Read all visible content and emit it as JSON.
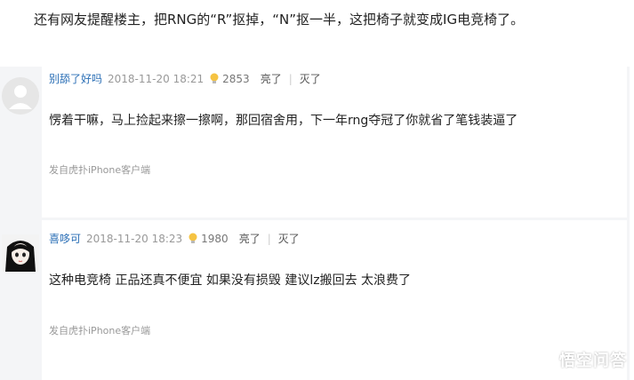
{
  "intro_text": "还有网友提醒楼主，把RNG的“R”抠掉，“N”抠一半，这把椅子就变成IG电竞椅了。",
  "comments": [
    {
      "username": "别舔了好吗",
      "timestamp": "2018-11-20 18:21",
      "likes": "2853",
      "upvote_label": "亮了",
      "downvote_label": "灭了",
      "separator": "|",
      "text": "愣着干嘛，马上捡起来擦一擦啊，那回宿舍用，下一年rng夺冠了你就省了笔钱装逼了",
      "device": "发自虎扑iPhone客户端"
    },
    {
      "username": "喜哆可",
      "timestamp": "2018-11-20 18:23",
      "likes": "1980",
      "upvote_label": "亮了",
      "downvote_label": "灭了",
      "separator": "|",
      "text": "这种电竞椅 正品还真不便宜 如果没有损毁 建议lz搬回去 太浪费了",
      "device": "发自虎扑iPhone客户端"
    }
  ],
  "watermark": "悟空问答",
  "colors": {
    "username": "#2b6fb6",
    "panel_bg": "#f4f5f7",
    "meta_text": "#999999"
  }
}
